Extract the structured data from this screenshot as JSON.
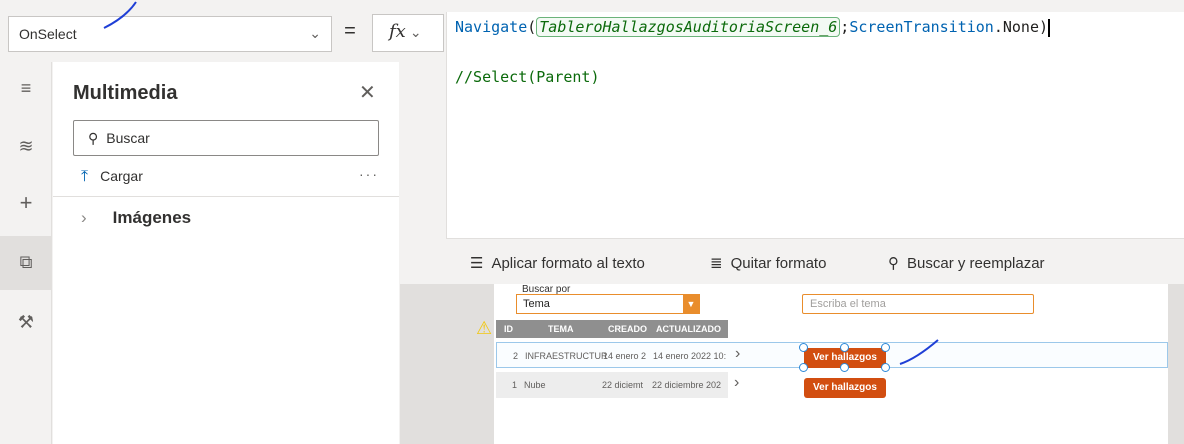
{
  "formula_bar": {
    "property": "OnSelect",
    "equals": "=",
    "fx_label": "fx",
    "code": {
      "fn": "Navigate",
      "paren_open": "(",
      "arg1": "TableroHallazgosAuditoriaScreen_6",
      "sep": ";",
      "arg2_obj": "ScreenTransition",
      "arg2_prop": ".None",
      "paren_close": ")",
      "line2": "//Select(Parent)"
    }
  },
  "format_bar": {
    "apply": "Aplicar formato al texto",
    "remove": "Quitar formato",
    "find": "Buscar y reemplazar"
  },
  "rail": {
    "items": [
      {
        "icon": "hamburger-icon",
        "glyph": "≡"
      },
      {
        "icon": "layers-icon",
        "glyph": "≋"
      },
      {
        "icon": "plus-icon",
        "glyph": "+"
      },
      {
        "icon": "media-icon",
        "glyph": "⧉"
      },
      {
        "icon": "tools-icon",
        "glyph": "⚒"
      }
    ]
  },
  "media_panel": {
    "title": "Multimedia",
    "search_placeholder": "Buscar",
    "upload": "Cargar",
    "more": "···",
    "folder": "Imágenes"
  },
  "app_screen": {
    "search_label": "Buscar por",
    "dropdown_value": "Tema",
    "text_input_placeholder": "Escriba el tema",
    "columns": [
      "ID",
      "TEMA",
      "CREADO",
      "ACTUALIZADO"
    ],
    "rows": [
      {
        "id": "2",
        "tema": "INFRAESTRUCTUR",
        "creado": "14 enero 2",
        "actualizado": "14 enero 2022 10:",
        "button": "Ver hallazgos"
      },
      {
        "id": "1",
        "tema": "Nube",
        "creado": "22 diciemt",
        "actualizado": "22 diciembre 202",
        "button": "Ver hallazgos"
      }
    ]
  },
  "colors": {
    "accent_orange": "#d24e10",
    "input_border": "#e98d2c",
    "code_blue": "#0063b1",
    "code_green": "#0b6a0b"
  }
}
